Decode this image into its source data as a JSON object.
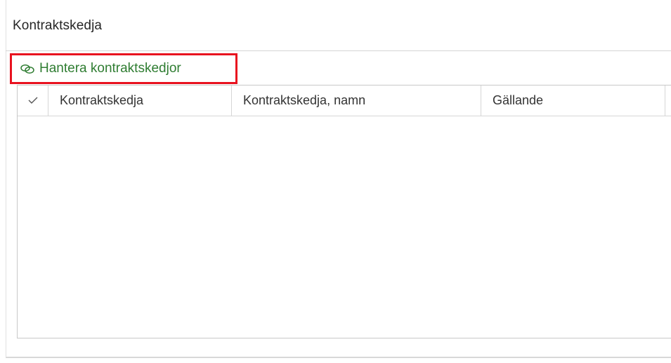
{
  "panel": {
    "title": "Kontraktskedja"
  },
  "actions": {
    "manage_label": "Hantera kontraktskedjor",
    "manage_icon": "link-icon",
    "link_color": "#2f7d32",
    "highlight_color": "#e8121f"
  },
  "grid": {
    "select_all_icon": "checkmark-icon",
    "columns": [
      {
        "label": "Kontraktskedja"
      },
      {
        "label": "Kontraktskedja, namn"
      },
      {
        "label": "Gällande"
      }
    ],
    "rows": []
  }
}
